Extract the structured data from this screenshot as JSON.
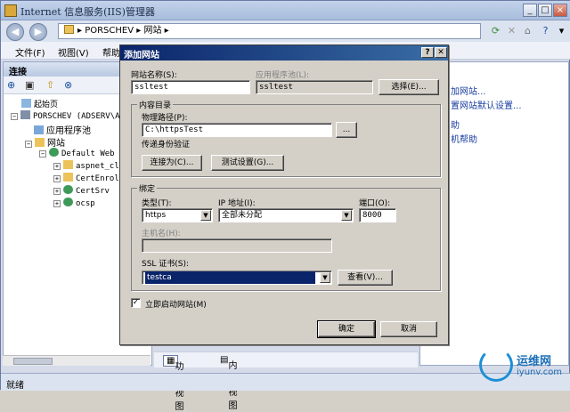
{
  "window": {
    "title": "Internet 信息服务(IIS)管理器"
  },
  "address": {
    "path": [
      "PORSCHEV",
      "网站"
    ]
  },
  "menu": {
    "file": "文件(F)",
    "view": "视图(V)",
    "help": "帮助"
  },
  "connections": {
    "header": "连接",
    "tree": [
      {
        "label": "起始页",
        "level": 0
      },
      {
        "label": "PORSCHEV (ADSERV\\Ac",
        "level": 0
      },
      {
        "label": "应用程序池",
        "level": 1
      },
      {
        "label": "网站",
        "level": 1
      },
      {
        "label": "Default Web S",
        "level": 2
      },
      {
        "label": "aspnet_cl",
        "level": 3
      },
      {
        "label": "CertEnrol",
        "level": 3
      },
      {
        "label": "CertSrv",
        "level": 3
      },
      {
        "label": "ocsp",
        "level": 3
      }
    ]
  },
  "actions": {
    "add_site": "加网站...",
    "set_defaults": "置网站默认设置...",
    "help": "助",
    "online_help": "机帮助"
  },
  "bottom_tabs": {
    "feature_view": "功能视图",
    "content_view": "内容视图"
  },
  "status": {
    "text": "就绪"
  },
  "watermark": {
    "name": "运维网",
    "url": "iyunv.com"
  },
  "dialog": {
    "title": "添加网站",
    "help_btn": "?",
    "close_btn": "✕",
    "site_name_label": "网站名称(S):",
    "site_name_value": "ssltest",
    "app_pool_label": "应用程序池(L):",
    "app_pool_value": "ssltest",
    "select_button": "选择(E)...",
    "content_dir_legend": "内容目录",
    "physical_path_label": "物理路径(P):",
    "physical_path_value": "C:\\httpsTest",
    "browse_button": "...",
    "pass_through_label": "传递身份验证",
    "connect_as_button": "连接为(C)...",
    "test_settings_button": "测试设置(G)...",
    "binding_legend": "绑定",
    "type_label": "类型(T):",
    "type_value": "https",
    "ip_label": "IP 地址(I):",
    "ip_value": "全部未分配",
    "port_label": "端口(O):",
    "port_value": "8000",
    "host_name_label": "主机名(H):",
    "host_name_value": "",
    "ssl_cert_label": "SSL 证书(S):",
    "ssl_cert_value": "testca",
    "view_button": "查看(V)...",
    "start_now_label": "立即启动网站(M)",
    "start_now_checked": true,
    "ok_button": "确定",
    "cancel_button": "取消"
  }
}
